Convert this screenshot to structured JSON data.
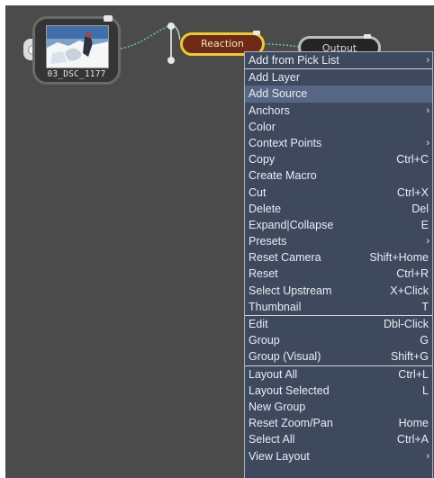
{
  "nodes": {
    "source": {
      "label": "03_DSC_1177"
    },
    "reaction": {
      "label": "Reaction"
    },
    "output": {
      "label": "Output"
    }
  },
  "colors": {
    "canvas": "#4b4b4b",
    "menu_bg": "#3e495e",
    "menu_highlight": "#566684",
    "menu_text": "#e9edf4",
    "reaction_fill": "#6e2a16",
    "reaction_border": "#e8c84a",
    "wire": "#6fc7c4"
  },
  "context_menu": {
    "header": {
      "label": "Add from Pick List",
      "submenu": true
    },
    "groups": [
      [
        {
          "label": "Add Layer",
          "shortcut": ""
        },
        {
          "label": "Add Source",
          "shortcut": "",
          "highlighted": true
        },
        {
          "label": "Anchors",
          "shortcut": "",
          "submenu": true
        },
        {
          "label": "Color",
          "shortcut": ""
        },
        {
          "label": "Context Points",
          "shortcut": "",
          "submenu": true
        },
        {
          "label": "Copy",
          "shortcut": "Ctrl+C"
        },
        {
          "label": "Create Macro",
          "shortcut": ""
        },
        {
          "label": "Cut",
          "shortcut": "Ctrl+X"
        },
        {
          "label": "Delete",
          "shortcut": "Del"
        },
        {
          "label": "Expand|Collapse",
          "shortcut": "E"
        },
        {
          "label": "Presets",
          "shortcut": "",
          "submenu": true
        },
        {
          "label": "Reset Camera",
          "shortcut": "Shift+Home"
        },
        {
          "label": "Reset",
          "shortcut": "Ctrl+R"
        },
        {
          "label": "Select Upstream",
          "shortcut": "X+Click"
        },
        {
          "label": "Thumbnail",
          "shortcut": "T"
        }
      ],
      [
        {
          "label": "Edit",
          "shortcut": "Dbl-Click"
        },
        {
          "label": "Group",
          "shortcut": "G"
        },
        {
          "label": "Group (Visual)",
          "shortcut": "Shift+G"
        }
      ],
      [
        {
          "label": "Layout All",
          "shortcut": "Ctrl+L"
        },
        {
          "label": "Layout Selected",
          "shortcut": "L"
        },
        {
          "label": "New Group",
          "shortcut": ""
        },
        {
          "label": "Reset Zoom/Pan",
          "shortcut": "Home"
        },
        {
          "label": "Select All",
          "shortcut": "Ctrl+A"
        },
        {
          "label": "View Layout",
          "shortcut": "",
          "submenu": true
        }
      ]
    ],
    "submenu_icon": "chevron-right-icon"
  }
}
